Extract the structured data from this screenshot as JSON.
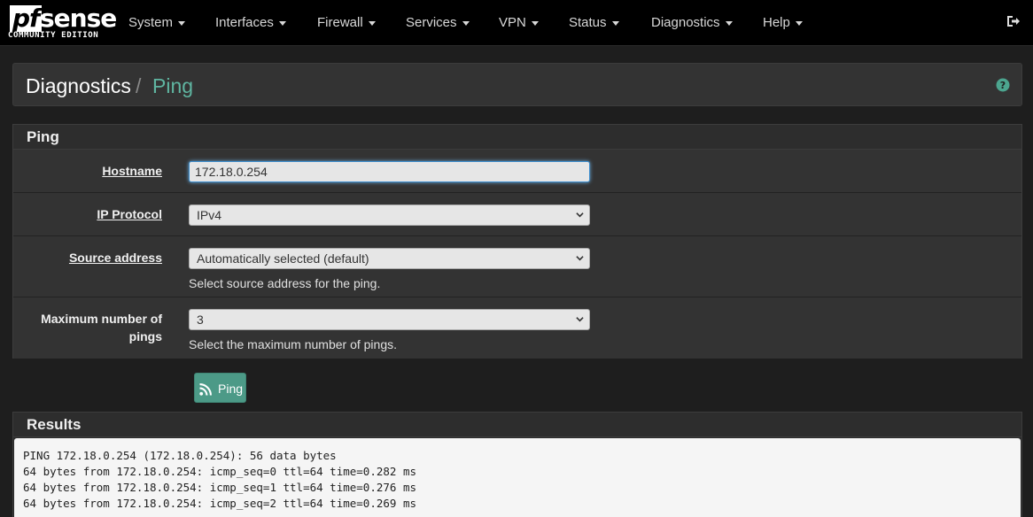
{
  "logo": {
    "brand_pf": "pf",
    "brand_sense": "sense",
    "edition": "COMMUNITY EDITION"
  },
  "nav": {
    "items": [
      {
        "label": "System"
      },
      {
        "label": "Interfaces"
      },
      {
        "label": "Firewall"
      },
      {
        "label": "Services"
      },
      {
        "label": "VPN"
      },
      {
        "label": "Status"
      },
      {
        "label": "Diagnostics"
      },
      {
        "label": "Help"
      }
    ],
    "logout_icon": "sign-out-icon"
  },
  "breadcrumb": {
    "parent": "Diagnostics",
    "separator": "/",
    "current": "Ping",
    "help_icon": "question-circle-icon"
  },
  "ping_panel": {
    "title": "Ping",
    "hostname": {
      "label": "Hostname",
      "value": "172.18.0.254"
    },
    "ip_protocol": {
      "label": "IP Protocol",
      "value": "IPv4"
    },
    "source_address": {
      "label": "Source address",
      "value": "Automatically selected (default)",
      "help": "Select source address for the ping."
    },
    "max_pings": {
      "label_line1": "Maximum number of",
      "label_line2": "pings",
      "value": "3",
      "help": "Select the maximum number of pings."
    },
    "button": {
      "label": "Ping",
      "icon": "rss-icon"
    }
  },
  "results": {
    "title": "Results",
    "lines": [
      "PING 172.18.0.254 (172.18.0.254): 56 data bytes",
      "64 bytes from 172.18.0.254: icmp_seq=0 ttl=64 time=0.282 ms",
      "64 bytes from 172.18.0.254: icmp_seq=1 ttl=64 time=0.276 ms",
      "64 bytes from 172.18.0.254: icmp_seq=2 ttl=64 time=0.269 ms"
    ]
  },
  "colors": {
    "accent": "#5fb5a1",
    "button": "#4c9a87",
    "navbar": "#000000",
    "page_bg": "#1e1e1e"
  }
}
